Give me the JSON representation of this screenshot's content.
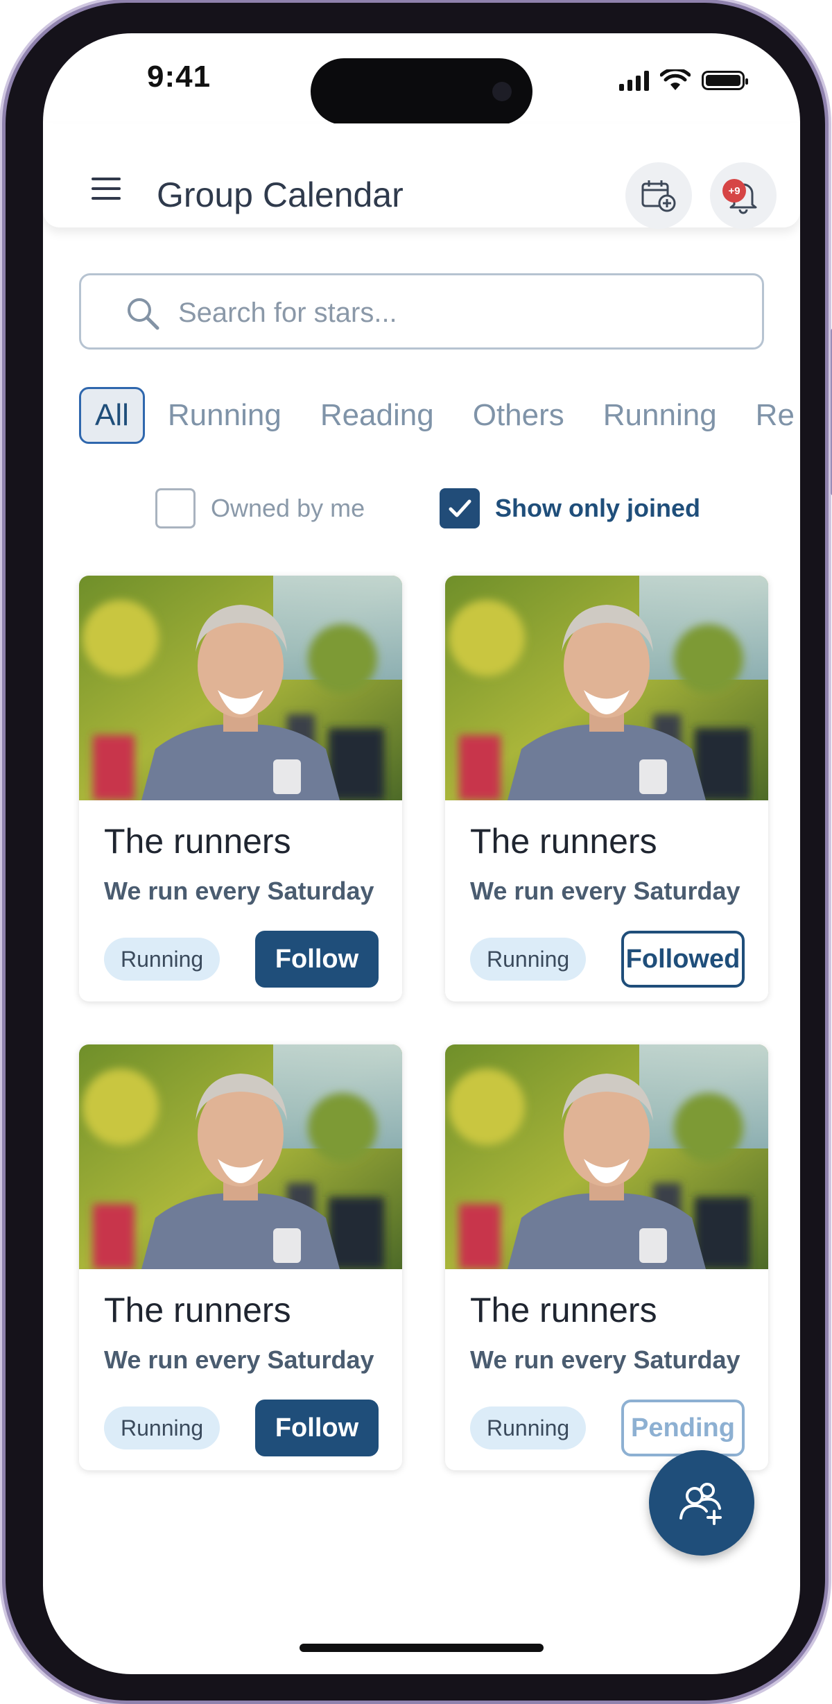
{
  "status_bar": {
    "time": "9:41"
  },
  "app_bar": {
    "title": "Group Calendar",
    "notification_badge": "+9",
    "icons": [
      "menu-icon",
      "calendar-add-icon",
      "bell-icon"
    ]
  },
  "search": {
    "placeholder": "Search for stars..."
  },
  "categories": [
    "All",
    "Running",
    "Reading",
    "Others",
    "Running",
    "Re"
  ],
  "selected_category": "All",
  "filters": {
    "owned_by_me": {
      "label": "Owned by me",
      "checked": false
    },
    "show_only_joined": {
      "label": "Show only joined",
      "checked": true
    }
  },
  "groups": [
    {
      "title": "The runners",
      "subtitle": "We run every Saturday",
      "tag": "Running",
      "action": "Follow",
      "state": "follow"
    },
    {
      "title": "The runners",
      "subtitle": "We run every Saturday",
      "tag": "Running",
      "action": "Followed",
      "state": "followed"
    },
    {
      "title": "The runners",
      "subtitle": "We run every Saturday",
      "tag": "Running",
      "action": "Follow",
      "state": "follow"
    },
    {
      "title": "The runners",
      "subtitle": "We run every Saturday",
      "tag": "Running",
      "action": "Pending",
      "state": "pending"
    }
  ],
  "colors": {
    "primary": "#1f4e7a",
    "chip_active_border": "#2f67ad",
    "tag_bg": "#dcecf8",
    "badge": "#d64545"
  }
}
